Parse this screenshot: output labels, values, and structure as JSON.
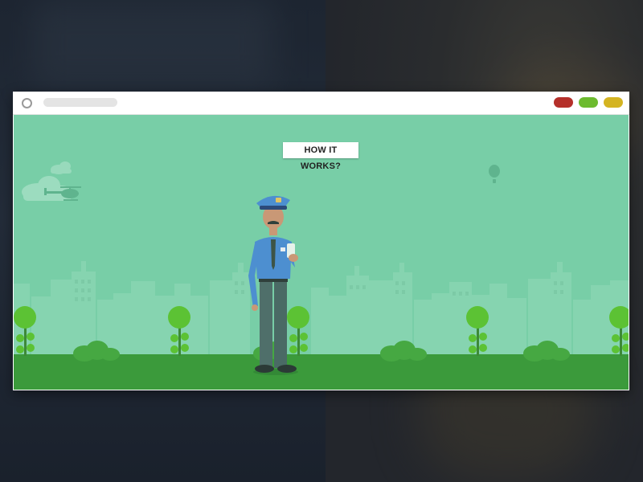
{
  "screen": {
    "background_colors": {
      "left": "#1d2531",
      "right": "#2a2c2e"
    }
  },
  "browser_window": {
    "address_bar_placeholder": "",
    "window_controls": [
      {
        "name": "close",
        "color": "#b5302a"
      },
      {
        "name": "minimize",
        "color": "#6dbb2f"
      },
      {
        "name": "maximize",
        "color": "#d4b422"
      }
    ]
  },
  "scene": {
    "button_label": "HOW IT WORKS?",
    "colors": {
      "sky": "#78cea7",
      "grass": "#3b9a3b",
      "buildings": "#8bd7b3",
      "trees": "#5cc234",
      "police_shirt": "#4d8fd0",
      "police_pants": "#4f6f6a"
    },
    "icons": [
      "cloud-icon",
      "helicopter-icon",
      "hot-air-balloon-icon",
      "policeman-figure",
      "tree-icon",
      "bush-icon",
      "city-buildings"
    ]
  }
}
